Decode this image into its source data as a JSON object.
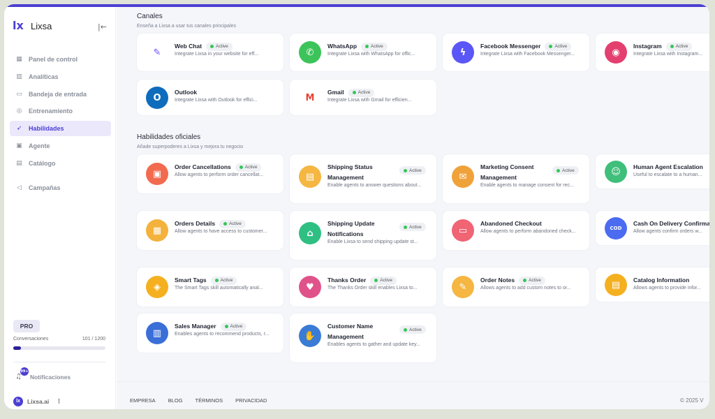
{
  "app": {
    "name": "Lixsa",
    "logo": "lx"
  },
  "sidebar": {
    "items": [
      {
        "label": "Panel de control",
        "icon": "grid-icon",
        "glyph": "▦"
      },
      {
        "label": "Analíticas",
        "icon": "chart-icon",
        "glyph": "▥"
      },
      {
        "label": "Bandeja de entrada",
        "icon": "inbox-icon",
        "glyph": "▭"
      },
      {
        "label": "Entrenamiento",
        "icon": "globe-icon",
        "glyph": "◎"
      },
      {
        "label": "Habilidades",
        "icon": "rocket-icon",
        "glyph": "➶",
        "active": true
      },
      {
        "label": "Agente",
        "icon": "terminal-icon",
        "glyph": "▣"
      },
      {
        "label": "Catálogo",
        "icon": "store-icon",
        "glyph": "▤"
      },
      {
        "label": "Campañas",
        "icon": "megaphone-icon",
        "glyph": "◁"
      }
    ],
    "plan": "PRO",
    "conversations_label": "Conversaciones",
    "conversations_count": "101 / 1200",
    "conversations_used_fraction": 0.084,
    "notifications_label": "Notificaciones",
    "notifications_badge": "99+",
    "user_name": "Lixsa.ai"
  },
  "channels": {
    "title": "Canales",
    "subtitle": "Enseña a Lixsa a usar tus canales principales",
    "items": [
      {
        "name": "Web Chat",
        "status": "Active",
        "desc": "Integrate Lixsa in your website for eff...",
        "icon": "chat-icon",
        "glyph": "✎",
        "color": "#ffffff",
        "fg": "#6a4cff"
      },
      {
        "name": "WhatsApp",
        "status": "Active",
        "desc": "Integrate Lixsa with WhatsApp for offic...",
        "icon": "whatsapp-icon",
        "glyph": "✆",
        "color": "#3cc45a",
        "fg": "#ffffff"
      },
      {
        "name": "Facebook Messenger",
        "status": "Active",
        "desc": "Integrate Lixsa with Facebook Messenger...",
        "icon": "messenger-icon",
        "glyph": "ϟ",
        "color": "#5b57f6",
        "fg": "#ffffff"
      },
      {
        "name": "Instagram",
        "status": "Active",
        "desc": "Integrate Lixsa with Instagram...",
        "icon": "instagram-icon",
        "glyph": "◉",
        "color": "#e4406f",
        "fg": "#ffffff"
      },
      {
        "name": "Outlook",
        "status": "",
        "desc": "Integrate Lixsa with Outlook for effici...",
        "icon": "outlook-icon",
        "glyph": "O",
        "color": "#0f6cbd",
        "fg": "#ffffff"
      },
      {
        "name": "Gmail",
        "status": "Active",
        "desc": "Integrate Lixsa with Gmail for efficien...",
        "icon": "gmail-icon",
        "glyph": "M",
        "color": "#ffffff",
        "fg": "#ea4335"
      }
    ]
  },
  "skills": {
    "title": "Habilidades oficiales",
    "subtitle": "Añade superpoderes a Lixsa y mejora tu negocio",
    "items": [
      {
        "name": "Order Cancellations",
        "status": "Active",
        "desc": "Allow agents to perform order cancellat...",
        "icon": "cancel-order-icon",
        "glyph": "▣",
        "color": "#f26b4f"
      },
      {
        "name": "Shipping Status Management",
        "status": "Active",
        "desc": "Enable agents to answer questions about...",
        "icon": "shipping-status-icon",
        "glyph": "▤",
        "color": "#f5b642"
      },
      {
        "name": "Marketing Consent Management",
        "status": "Active",
        "desc": "Enable agents to manage consent for rec...",
        "icon": "consent-icon",
        "glyph": "✉",
        "color": "#f0a23a"
      },
      {
        "name": "Human Agent Escalation",
        "status": "",
        "desc": "Useful to escalate to a human...",
        "icon": "escalation-icon",
        "glyph": "☺",
        "color": "#3fbf7a"
      },
      {
        "name": "Orders Details",
        "status": "Active",
        "desc": "Allow agents to have access to customer...",
        "icon": "order-details-icon",
        "glyph": "▦",
        "color": "#f3b23c"
      },
      {
        "name": "Shipping Update Notifications",
        "status": "Active",
        "desc": "Enable Lixsa to send shipping update st...",
        "icon": "shipping-update-icon",
        "glyph": "⌂",
        "color": "#2fbf83"
      },
      {
        "name": "Abandoned Checkout",
        "status": "",
        "desc": "Allow agents to perform abandoned check...",
        "icon": "checkout-icon",
        "glyph": "▭",
        "color": "#f06474"
      },
      {
        "name": "Cash On Delivery Confirmation",
        "status": "",
        "desc": "Allow agents confirm orders w...",
        "icon": "cod-icon",
        "glyph": "COD",
        "color": "#4b6cf0"
      },
      {
        "name": "Smart Tags",
        "status": "Active",
        "desc": "The Smart Tags skill automatically anal...",
        "icon": "tag-icon",
        "glyph": "◈",
        "color": "#f5b020"
      },
      {
        "name": "Thanks Order",
        "status": "Active",
        "desc": "The Thanks Order skill enables Lixsa to...",
        "icon": "thanks-icon",
        "glyph": "♥",
        "color": "#e0528a"
      },
      {
        "name": "Order Notes",
        "status": "Active",
        "desc": "Allows agents to add custom notes to or...",
        "icon": "notes-icon",
        "glyph": "✎",
        "color": "#f5b642"
      },
      {
        "name": "Catalog Information",
        "status": "",
        "desc": "Allows agents to provide infor...",
        "icon": "catalog-icon",
        "glyph": "▤",
        "color": "#f5b020"
      },
      {
        "name": "Sales Manager",
        "status": "Active",
        "desc": "Enables agents to recommend products, r...",
        "icon": "store-icon",
        "glyph": "▥",
        "color": "#3b6fd8"
      },
      {
        "name": "Customer Name Management",
        "status": "Active",
        "desc": "Enables agents to gather and update key...",
        "icon": "customer-icon",
        "glyph": "✋",
        "color": "#3a7bd5"
      }
    ]
  },
  "footer": {
    "links": [
      "EMPRESA",
      "BLOG",
      "TÉRMINOS",
      "PRIVACIDAD"
    ],
    "copyright": "© 2025 V"
  }
}
